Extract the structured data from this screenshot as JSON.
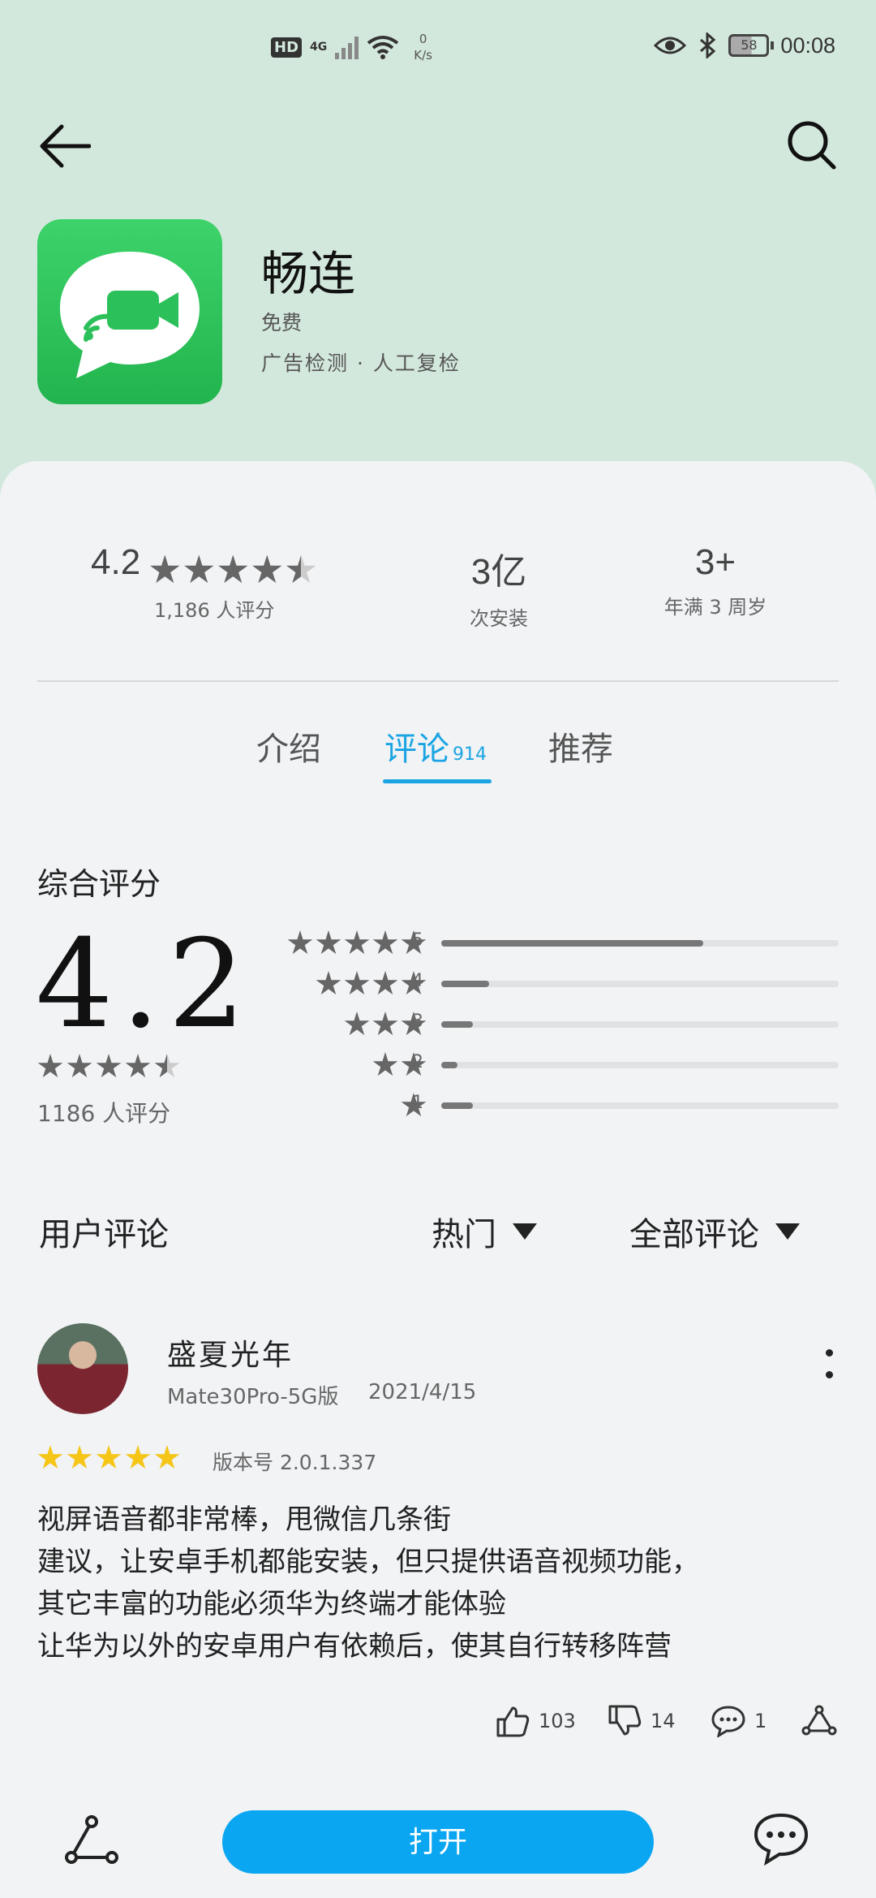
{
  "status_bar": {
    "hd": "HD",
    "network": "4G",
    "speed_value": "0",
    "speed_unit": "K/s",
    "battery": "58",
    "time": "00:08"
  },
  "icons": {
    "back": "arrow-left-icon",
    "search": "search-icon",
    "app": "video-chat-icon",
    "more": "more-vertical-icon",
    "like": "thumbs-up-icon",
    "dislike": "thumbs-down-icon",
    "comment": "comment-icon",
    "share": "share-icon",
    "chat": "chat-bubble-icon"
  },
  "app": {
    "name": "畅连",
    "price": "免费",
    "checks": "广告检测 · 人工复检"
  },
  "stats": {
    "rating": "4.2",
    "rating_stars": 4.5,
    "rating_count": "1,186 人评分",
    "installs": "3亿",
    "installs_label": "次安装",
    "age": "3+",
    "age_label": "年满 3 周岁"
  },
  "tabs": [
    {
      "label": "介绍"
    },
    {
      "label": "评论",
      "count": "914"
    },
    {
      "label": "推荐"
    }
  ],
  "overall": {
    "title": "综合评分",
    "score": "4.2",
    "stars": 4.5,
    "count": "1186 人评分",
    "distribution": [
      {
        "stars": "5",
        "fraction": 0.66
      },
      {
        "stars": "4",
        "fraction": 0.12
      },
      {
        "stars": "3",
        "fraction": 0.08
      },
      {
        "stars": "2",
        "fraction": 0.04
      },
      {
        "stars": "1",
        "fraction": 0.08
      }
    ]
  },
  "reviews_header": {
    "title": "用户评论",
    "sort": "热门",
    "filter": "全部评论"
  },
  "review": {
    "user": "盛夏光年",
    "device": "Mate30Pro-5G版",
    "date": "2021/4/15",
    "stars": 5,
    "version": "版本号 2.0.1.337",
    "text": "视屏语音都非常棒，甩微信几条街\n建议，让安卓手机都能安装，但只提供语音视频功能，\n其它丰富的功能必须华为终端才能体验\n让华为以外的安卓用户有依赖后，使其自行转移阵营",
    "likes": "103",
    "dislikes": "14",
    "comments": "1"
  },
  "bottom": {
    "open": "打开"
  },
  "colors": {
    "accent": "#1ba4e3",
    "open_button": "#0aa6f2",
    "hero_bg": "#d3e8dc",
    "star_yellow": "#f5c518"
  }
}
